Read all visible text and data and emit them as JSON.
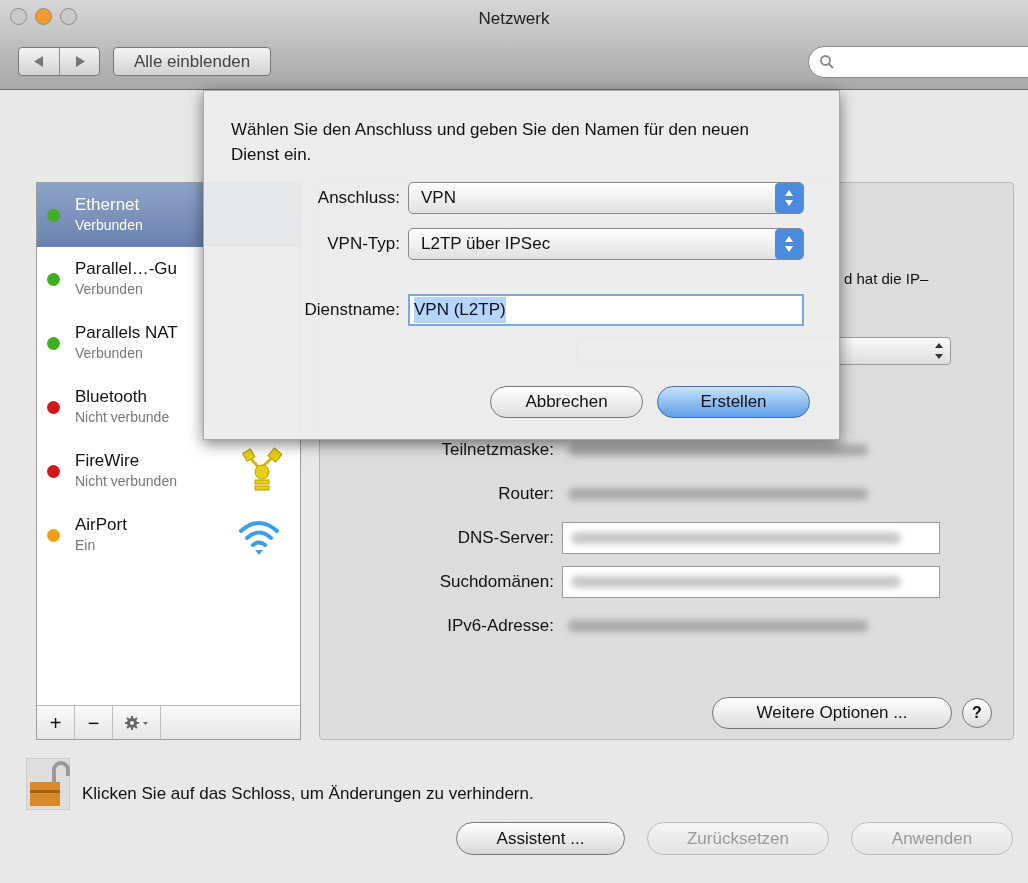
{
  "window": {
    "title": "Netzwerk"
  },
  "toolbar": {
    "show_all_button": "Alle einblenden"
  },
  "services": [
    {
      "name": "Ethernet",
      "status": "Verbunden",
      "color": "#3fae1f",
      "selected": true,
      "kind": "hidden"
    },
    {
      "name": "Parallel…-Gu",
      "status": "Verbunden",
      "color": "#3fae1f",
      "selected": false,
      "kind": "hidden"
    },
    {
      "name": "Parallels NAT",
      "status": "Verbunden",
      "color": "#3fae1f",
      "selected": false,
      "kind": "hidden"
    },
    {
      "name": "Bluetooth",
      "status": "Nicht verbunde",
      "color": "#d01818",
      "selected": false,
      "kind": "hidden"
    },
    {
      "name": "FireWire",
      "status": "Nicht verbunden",
      "color": "#d01818",
      "selected": false,
      "kind": "firewire"
    },
    {
      "name": "AirPort",
      "status": "Ein",
      "color": "#f0a010",
      "selected": false,
      "kind": "wifi"
    }
  ],
  "service_toolbar": {
    "add": "+",
    "remove": "−"
  },
  "details": {
    "status_tail": "d hat die IP–",
    "rows": [
      {
        "label": "Teilnetzmaske:",
        "kind": "value"
      },
      {
        "label": "Router:",
        "kind": "value"
      },
      {
        "label": "DNS-Server:",
        "kind": "field"
      },
      {
        "label": "Suchdomänen:",
        "kind": "field"
      },
      {
        "label": "IPv6-Adresse:",
        "kind": "value"
      }
    ],
    "advanced_button": "Weitere Optionen ...",
    "help": "?"
  },
  "lock": {
    "locked": false,
    "text": "Klicken Sie auf das Schloss, um Änderungen zu verhindern."
  },
  "buttons": [
    {
      "label": "Assistent ...",
      "disabled": false
    },
    {
      "label": "Zurücksetzen",
      "disabled": true
    },
    {
      "label": "Anwenden",
      "disabled": true
    }
  ],
  "sheet": {
    "prompt": "Wählen Sie den Anschluss und geben Sie den Namen für den neuen Dienst ein.",
    "fields": [
      {
        "label": "Anschluss:",
        "kind": "popup",
        "value": "VPN"
      },
      {
        "label": "VPN-Typ:",
        "kind": "popup",
        "value": "L2TP über IPSec"
      },
      {
        "label": "Dienstname:",
        "kind": "text",
        "value": "VPN (L2TP)",
        "text_selected": true
      }
    ],
    "buttons": [
      {
        "label": "Abbrechen",
        "default": false
      },
      {
        "label": "Erstellen",
        "default": true
      }
    ]
  }
}
